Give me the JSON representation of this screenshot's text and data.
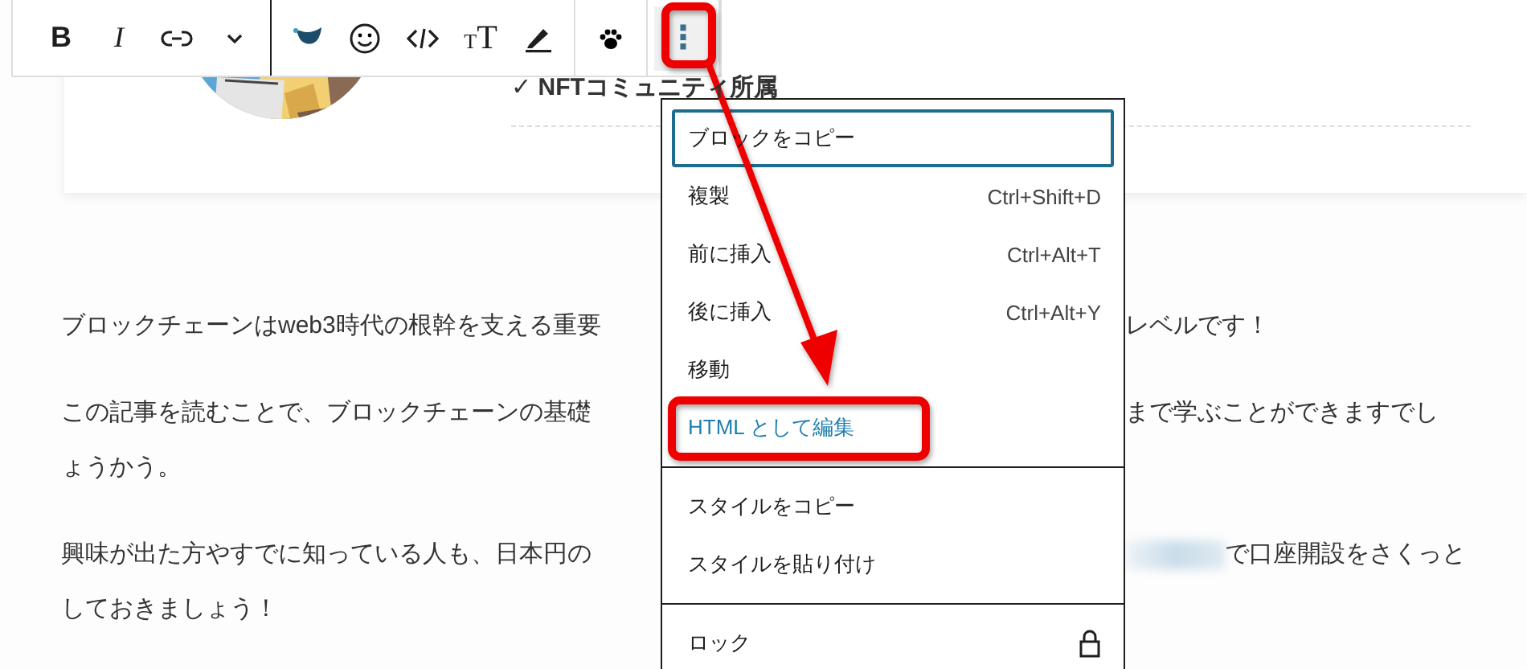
{
  "toolbar": {
    "groups": [
      {
        "buttons": [
          {
            "kind": "bold",
            "label": "B",
            "selected": false
          },
          {
            "kind": "italic",
            "label": "I",
            "selected": false
          },
          {
            "kind": "link",
            "selected": false
          },
          {
            "kind": "chevron",
            "selected": false
          }
        ]
      },
      {
        "buttons": [
          {
            "kind": "bird",
            "selected": false
          },
          {
            "kind": "emoji",
            "selected": false
          },
          {
            "kind": "code",
            "selected": false
          },
          {
            "kind": "text-size",
            "label": "TT",
            "selected": false
          },
          {
            "kind": "highlighter",
            "selected": false
          }
        ]
      },
      {
        "buttons": [
          {
            "kind": "paw",
            "selected": false
          }
        ]
      },
      {
        "buttons": [
          {
            "kind": "more",
            "label": "⋮",
            "selected": true
          }
        ]
      }
    ]
  },
  "profile_card": {
    "badge": "✓ NFTコミュニティ所属"
  },
  "paragraphs": [
    {
      "lines": [
        {
          "left": "ブロックチェーンはweb3時代の根幹を支える重要",
          "right": "レベルです！",
          "blurred": false
        }
      ]
    },
    {
      "lines": [
        {
          "left": "この記事を読むことで、ブロックチェーンの基礎",
          "right": "まで学ぶことができますでし",
          "blurred": false
        },
        {
          "left": "ょうかう。",
          "blurred": false
        }
      ]
    },
    {
      "lines": [
        {
          "left": "興味が出た方やすでに知っている人も、日本円の",
          "right": "で口座開設をさくっと",
          "blurred": true
        },
        {
          "left": "しておきましょう！",
          "blurred": false
        }
      ]
    }
  ],
  "menu": {
    "groups": [
      {
        "items": [
          {
            "kind": "action",
            "label": "ブロックをコピー",
            "focused": true,
            "hovered": false
          },
          {
            "kind": "action",
            "label": "複製",
            "shortcut": "Ctrl+Shift+D",
            "focused": false,
            "hovered": false
          },
          {
            "kind": "action",
            "label": "前に挿入",
            "shortcut": "Ctrl+Alt+T",
            "focused": false,
            "hovered": false
          },
          {
            "kind": "action",
            "label": "後に挿入",
            "shortcut": "Ctrl+Alt+Y",
            "focused": false,
            "hovered": false
          },
          {
            "kind": "action",
            "label": "移動",
            "focused": false,
            "hovered": false
          },
          {
            "kind": "action",
            "label": "HTML として編集",
            "focused": false,
            "hovered": true
          }
        ]
      },
      {
        "items": [
          {
            "kind": "action",
            "label": "スタイルをコピー",
            "focused": false,
            "hovered": false
          },
          {
            "kind": "action",
            "label": "スタイルを貼り付け",
            "focused": false,
            "hovered": false
          }
        ]
      },
      {
        "items": [
          {
            "kind": "lock",
            "label": "ロック",
            "focused": false,
            "hovered": false
          }
        ]
      }
    ]
  },
  "annotations": [
    {
      "kind": "box"
    },
    {
      "kind": "box"
    },
    {
      "kind": "arrow"
    }
  ]
}
